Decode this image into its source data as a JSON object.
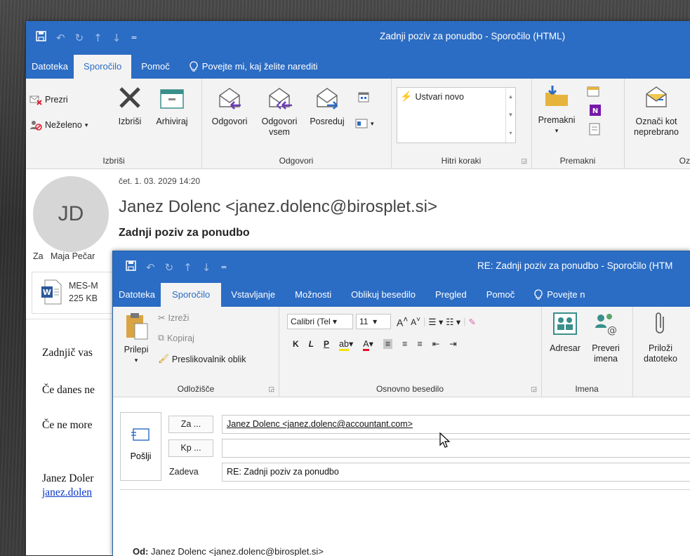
{
  "main_window": {
    "title": "Zadnji poziv za ponudbo  -  Sporočilo (HTML)",
    "tabs": [
      {
        "label": "Datoteka"
      },
      {
        "label": "Sporočilo"
      },
      {
        "label": "Pomoč"
      }
    ],
    "tell_me": "Povejte mi, kaj želite narediti",
    "ribbon": {
      "delete_group": {
        "label": "Izbriši",
        "ignore": "Prezri",
        "junk": "Neželeno",
        "delete": "Izbriši",
        "archive": "Arhiviraj"
      },
      "respond_group": {
        "label": "Odgovori",
        "reply": "Odgovori",
        "reply_all_1": "Odgovori",
        "reply_all_2": "vsem",
        "forward": "Posreduj"
      },
      "quick_steps_group": {
        "label": "Hitri koraki",
        "create_new": "Ustvari novo"
      },
      "move_group": {
        "label": "Premakni",
        "move": "Premakni"
      },
      "tags_group": {
        "label": "Oznake",
        "mark_unread_1": "Označi kot",
        "mark_unread_2": "neprebrano"
      }
    },
    "header": {
      "avatar_initials": "JD",
      "date": "čet. 1. 03. 2029 14:20",
      "from": "Janez Dolenc <janez.dolenc@birosplet.si>",
      "subject": "Zadnji poziv za ponudbo",
      "to_label": "Za",
      "to_value": "Maja Pečar"
    },
    "attachment": {
      "name": "MES-M",
      "size": "225 KB"
    },
    "body_lines": [
      "Zadnjič vas",
      "Če danes ne",
      "Če ne more",
      "Janez Doler",
      "janez.dolen"
    ]
  },
  "reply_window": {
    "title": "RE: Zadnji poziv za ponudbo  -  Sporočilo (HTM",
    "tabs": [
      {
        "label": "Datoteka"
      },
      {
        "label": "Sporočilo"
      },
      {
        "label": "Vstavljanje"
      },
      {
        "label": "Možnosti"
      },
      {
        "label": "Oblikuj besedilo"
      },
      {
        "label": "Pregled"
      },
      {
        "label": "Pomoč"
      }
    ],
    "tell_me": "Povejte n",
    "ribbon": {
      "clipboard_group": {
        "label": "Odložišče",
        "paste": "Prilepi",
        "cut": "Izreži",
        "copy": "Kopiraj",
        "format_painter": "Preslikovalnik oblik"
      },
      "basic_text_group": {
        "label": "Osnovno besedilo",
        "font": "Calibri (Tel",
        "size": "11",
        "bold": "K",
        "italic": "L",
        "underline": "P"
      },
      "names_group": {
        "label": "Imena",
        "address_book": "Adresar",
        "check_names_1": "Preveri",
        "check_names_2": "imena"
      },
      "include_group": {
        "attach_1": "Priloži",
        "attach_2": "datoteko"
      }
    },
    "compose": {
      "send": "Pošlji",
      "to_button": "Za ...",
      "cc_button": "Kp ...",
      "subject_label": "Zadeva",
      "to_value": "Janez Dolenc <janez.dolenc@accountant.com>",
      "cc_value": "",
      "subject_value": "RE: Zadnji poziv za ponudbo",
      "quoted_from_label": "Od:",
      "quoted_from_value": "Janez Dolenc <janez.dolenc@birosplet.si>"
    }
  },
  "colors": {
    "title_blue": "#2b6cc4",
    "ribbon_bg": "#f3f3f3",
    "accent_purple": "#6a3cb5"
  }
}
